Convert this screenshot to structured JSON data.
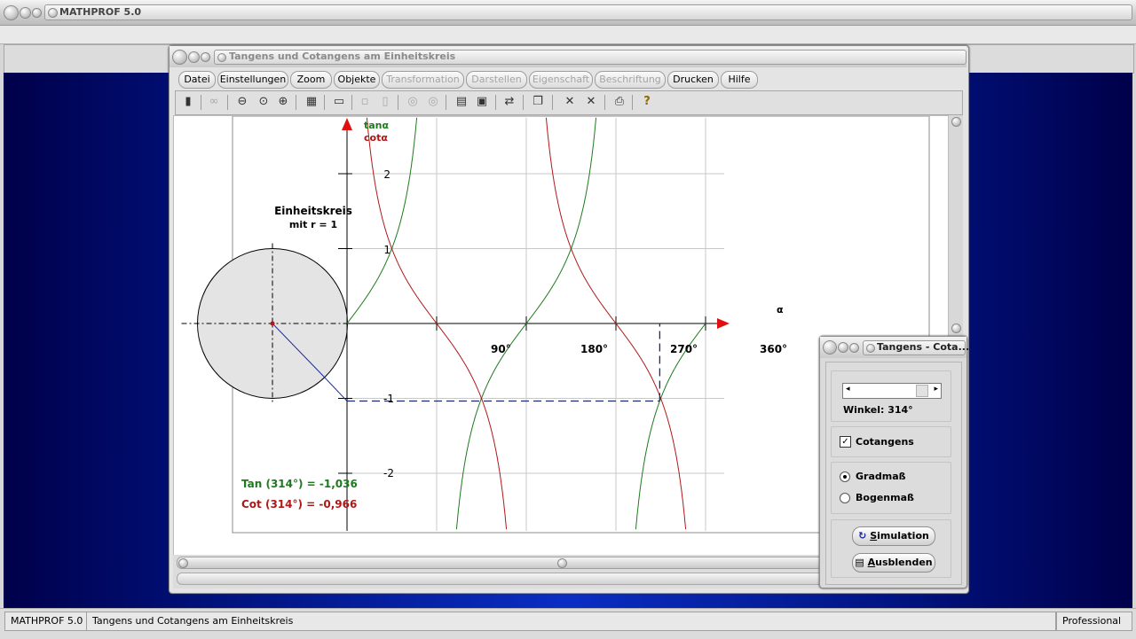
{
  "app": {
    "title": "MATHPROF 5.0"
  },
  "doc_window": {
    "title": "Tangens und Cotangens am Einheitskreis",
    "menus": [
      {
        "label": "Datei",
        "enabled": true
      },
      {
        "label": "Einstellungen",
        "enabled": true
      },
      {
        "label": "Zoom",
        "enabled": true
      },
      {
        "label": "Objekte",
        "enabled": true
      },
      {
        "label": "Transformation",
        "enabled": false
      },
      {
        "label": "Darstellen",
        "enabled": false
      },
      {
        "label": "Eigenschaft",
        "enabled": false
      },
      {
        "label": "Beschriftung",
        "enabled": false
      },
      {
        "label": "Drucken",
        "enabled": true
      },
      {
        "label": "Hilfe",
        "enabled": true
      }
    ]
  },
  "plot": {
    "legend_tan": "tanα",
    "legend_cot": "cotα",
    "x_axis_label": "α",
    "x_ticks": [
      "90°",
      "180°",
      "270°",
      "360°"
    ],
    "y_ticks": [
      "2",
      "1",
      "-1",
      "-2"
    ],
    "circle_title": "Einheitskreis",
    "circle_subtitle": "mit r = 1",
    "tan_readout": "Tan (314°) = -1,036",
    "cot_readout": "Cot (314°) = -0,966",
    "colors": {
      "tan": "#1e7a1e",
      "cot": "#b01818",
      "axis_arrow": "#e01010",
      "radius": "#1c2a9c"
    }
  },
  "tool_window": {
    "title": "Tangens - Cota...",
    "angle_label": "Winkel: 314°",
    "angle_deg": 314,
    "cotangens_label": "Cotangens",
    "cotangens_checked": true,
    "radio_options": [
      "Gradmaß",
      "Bogenmaß"
    ],
    "radio_selected": "Gradmaß",
    "simulation_prefix": "",
    "simulation_accel": "S",
    "simulation_rest": "imulation",
    "hide_accel": "A",
    "hide_rest": "usblenden"
  },
  "status": {
    "app": "MATHPROF 5.0",
    "doc": "Tangens und Cotangens am Einheitskreis",
    "edition": "Professional"
  },
  "chart_data": {
    "type": "line",
    "xlabel": "α",
    "x_ticks": [
      90,
      180,
      270,
      360
    ],
    "y_ticks": [
      2,
      1,
      -1,
      -2
    ],
    "ylim": [
      -2.75,
      2.75
    ],
    "series": [
      {
        "name": "tanα",
        "function": "tan",
        "color": "#1e7a1e"
      },
      {
        "name": "cotα",
        "function": "cot",
        "color": "#b01818"
      }
    ],
    "marker_angle": 314,
    "annotations": [
      "Tan (314°) = -1,036",
      "Cot (314°) = -0,966"
    ]
  }
}
